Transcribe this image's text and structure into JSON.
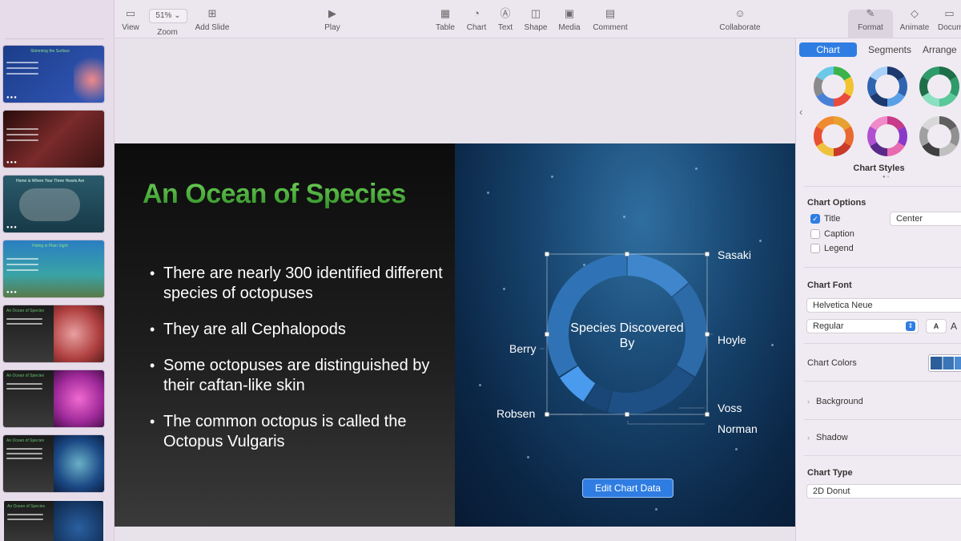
{
  "toolbar": {
    "zoom_value": "51%",
    "items": {
      "view": "View",
      "zoom": "Zoom",
      "add_slide": "Add Slide",
      "play": "Play",
      "table": "Table",
      "chart": "Chart",
      "text": "Text",
      "shape": "Shape",
      "media": "Media",
      "comment": "Comment",
      "collaborate": "Collaborate",
      "format": "Format",
      "animate": "Animate",
      "document": "Document"
    }
  },
  "navigator": {
    "thumbnails": [
      {
        "title": "Skimming the Surface"
      },
      {
        "title": ""
      },
      {
        "title": "Home is Where Your Three Hearts Are"
      },
      {
        "title": "Hiding in Plain Sight"
      },
      {
        "title": "An Ocean of Species"
      },
      {
        "title": "An Ocean of Species"
      },
      {
        "title": "An Ocean of Species"
      },
      {
        "title": "An Ocean of Species"
      }
    ]
  },
  "slide": {
    "title": "An Ocean of Species",
    "bullets": [
      "There are nearly 300 identified different species of octopuses",
      "They are all Cephalopods",
      "Some octopuses are distinguished by their caftan-like skin",
      "The common octopus is called the Octopus Vulgaris"
    ],
    "edit_chart_button": "Edit Chart Data"
  },
  "chart_data": {
    "type": "pie",
    "variant": "2D Donut",
    "title": "Species Discovered By",
    "title_position": "center",
    "categories": [
      "Sasaki",
      "Hoyle",
      "Voss",
      "Norman",
      "Robsen",
      "Berry"
    ],
    "values": [
      14,
      20,
      20,
      5,
      7,
      34
    ],
    "colors": [
      "#3f86cc",
      "#2d6aa8",
      "#1f5085",
      "#1a4677",
      "#4a9bee",
      "#2f73b6"
    ],
    "legend": false,
    "caption": false
  },
  "inspector": {
    "tabs": [
      "Chart",
      "Segments",
      "Arrange"
    ],
    "chart_styles_label": "Chart Styles",
    "chart_options_label": "Chart Options",
    "options": {
      "title": {
        "label": "Title",
        "checked": true,
        "position": "Center"
      },
      "caption": {
        "label": "Caption",
        "checked": false
      },
      "legend": {
        "label": "Legend",
        "checked": false
      }
    },
    "chart_font_label": "Chart Font",
    "font_family": "Helvetica Neue",
    "font_style": "Regular",
    "font_size_button": "A",
    "chart_colors_label": "Chart Colors",
    "background_label": "Background",
    "shadow_label": "Shadow",
    "chart_type_label": "Chart Type",
    "chart_type_value": "2D Donut"
  }
}
